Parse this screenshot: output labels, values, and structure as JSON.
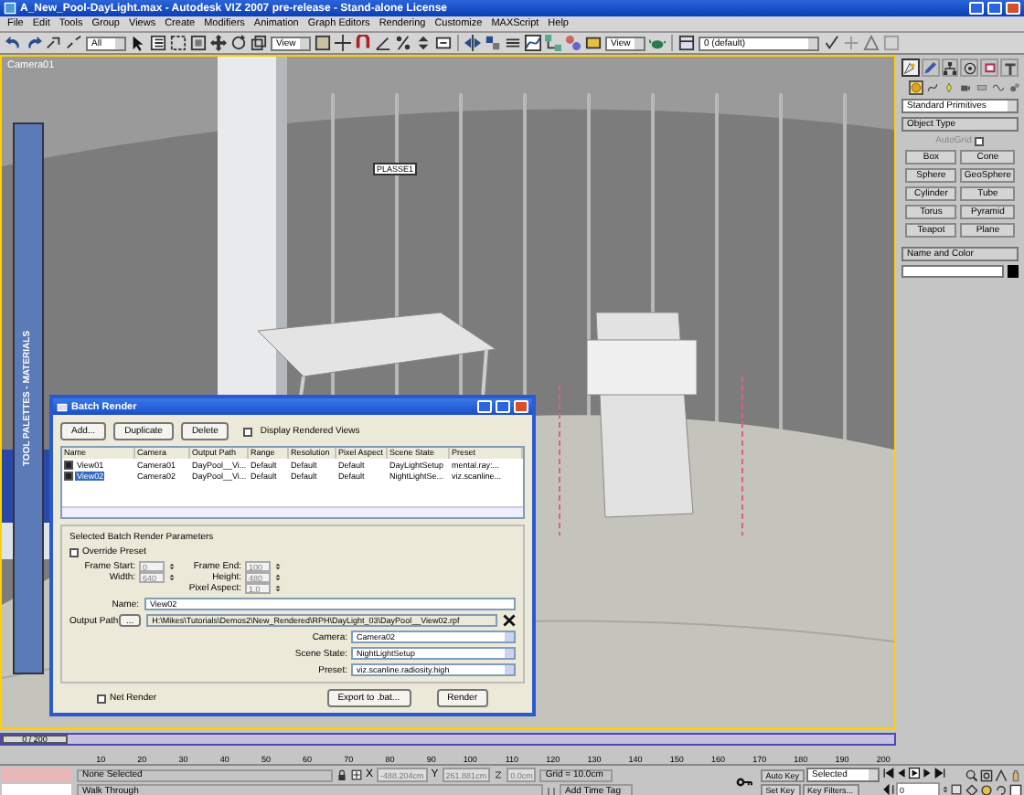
{
  "window": {
    "title": "A_New_Pool-DayLight.max - Autodesk VIZ 2007 pre-release - Stand-alone License"
  },
  "menu": [
    "File",
    "Edit",
    "Tools",
    "Group",
    "Views",
    "Create",
    "Modifiers",
    "Animation",
    "Graph Editors",
    "Rendering",
    "Customize",
    "MAXScript",
    "Help"
  ],
  "toolbar": {
    "selection_filter": "All",
    "ref_coord": "View",
    "view_mode": "View",
    "layer": "0 (default)"
  },
  "viewport": {
    "label": "Camera01",
    "object_tag": "PLASSE1"
  },
  "tool_palette": {
    "title": "TOOL PALETTES - MATERIALS"
  },
  "command_panel": {
    "tabs": [
      {
        "kind": "create",
        "selected": true
      },
      {
        "kind": "modify",
        "selected": false
      },
      {
        "kind": "hierarchy",
        "selected": false
      },
      {
        "kind": "motion",
        "selected": false
      },
      {
        "kind": "display",
        "selected": false
      },
      {
        "kind": "utilities",
        "selected": false
      }
    ],
    "categories": [
      {
        "kind": "geometry",
        "selected": true
      },
      {
        "kind": "shapes",
        "selected": false
      },
      {
        "kind": "lights",
        "selected": false
      },
      {
        "kind": "cameras",
        "selected": false
      },
      {
        "kind": "helpers",
        "selected": false
      },
      {
        "kind": "spacewarps",
        "selected": false
      },
      {
        "kind": "systems",
        "selected": false
      }
    ],
    "dropdown": "Standard Primitives",
    "object_type": {
      "title": "Object Type",
      "autogrid": {
        "label": "AutoGrid",
        "checked": false
      },
      "buttons": [
        "Box",
        "Cone",
        "Sphere",
        "GeoSphere",
        "Cylinder",
        "Tube",
        "Torus",
        "Pyramid",
        "Teapot",
        "Plane"
      ]
    },
    "name_and_color": {
      "title": "Name and Color"
    }
  },
  "batch_render": {
    "title": "Batch Render",
    "buttons": [
      "Add...",
      "Duplicate",
      "Delete"
    ],
    "display_rendered": {
      "label": "Display Rendered Views",
      "checked": false
    },
    "columns": [
      "Name",
      "Camera",
      "Output Path",
      "Range",
      "Resolution",
      "Pixel Aspect",
      "Scene State",
      "Preset"
    ],
    "rows": [
      {
        "checked": true,
        "selected": false,
        "cells": [
          "View01",
          "Camera01",
          "DayPool__Vi...",
          "Default",
          "Default",
          "Default",
          "DayLightSetup",
          "mental.ray:..."
        ]
      },
      {
        "checked": true,
        "selected": true,
        "cells": [
          "View02",
          "Camera02",
          "DayPool__Vi...",
          "Default",
          "Default",
          "Default",
          "NightLightSe...",
          "viz.scanline..."
        ]
      }
    ],
    "group_title": "Selected Batch Render Parameters",
    "override_preset": {
      "label": "Override Preset",
      "checked": false
    },
    "frame_start": {
      "label": "Frame Start:",
      "value": "0",
      "disabled": true
    },
    "frame_end": {
      "label": "Frame End:",
      "value": "100",
      "disabled": true
    },
    "width": {
      "label": "Width:",
      "value": "640",
      "disabled": true
    },
    "height": {
      "label": "Height:",
      "value": "480",
      "disabled": true
    },
    "pixel_aspect": {
      "label": "Pixel Aspect:",
      "value": "1.0",
      "disabled": true
    },
    "name": {
      "label": "Name:",
      "value": "View02"
    },
    "output_path": {
      "label": "Output Path:",
      "browse": "...",
      "value": "H:\\Mikes\\Tutorials\\Demos2\\New_Rendered\\RPH\\DayLight_03\\DayPool__View02.rpf"
    },
    "camera": {
      "label": "Camera:",
      "value": "Camera02"
    },
    "scene_state": {
      "label": "Scene State:",
      "value": "NightLightSetup"
    },
    "preset": {
      "label": "Preset:",
      "value": "viz.scanline.radiosity.high"
    },
    "net_render": {
      "label": "Net Render",
      "checked": false
    },
    "export_button": "Export to .bat...",
    "render_button": "Render"
  },
  "time_slider": {
    "label": "0 / 200",
    "level": 0
  },
  "track_bar": {
    "labels": [
      "10",
      "20",
      "30",
      "40",
      "50",
      "60",
      "70",
      "80",
      "90",
      "100",
      "110",
      "120",
      "130",
      "140",
      "150",
      "160",
      "170",
      "180",
      "190",
      "200"
    ]
  },
  "status": {
    "selection": "None Selected",
    "prompt": "Walk Through",
    "x_label": "X",
    "x": "-488.204cm",
    "y_label": "Y",
    "y": "261.881cm",
    "z": "0.0cm",
    "grid": "Grid = 10.0cm",
    "auto_key": "Auto Key",
    "key_mode": "Selected",
    "set_key": "Set Key",
    "key_filters": "Key Filters...",
    "add_time_tag": "Add Time Tag",
    "frame": "0"
  }
}
